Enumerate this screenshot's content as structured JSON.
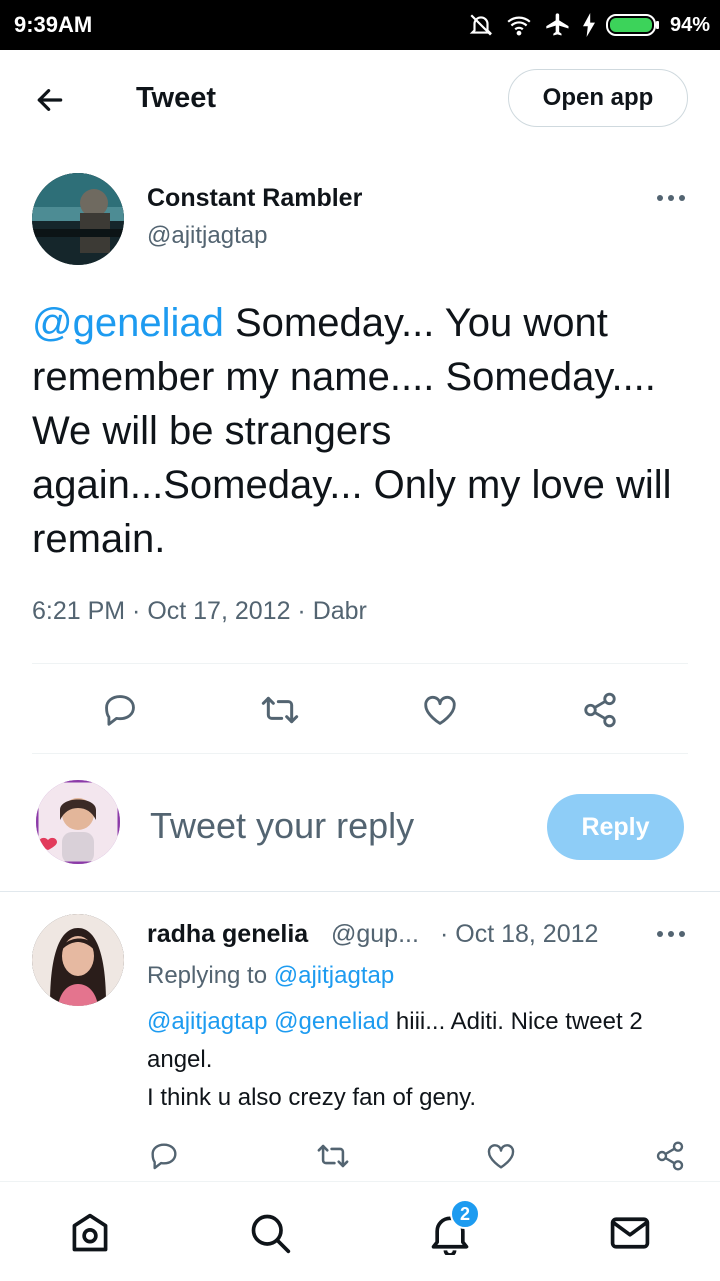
{
  "status_bar": {
    "time": "9:39AM",
    "battery": "94%"
  },
  "header": {
    "title": "Tweet",
    "open_app_label": "Open app"
  },
  "tweet": {
    "author_name": "Constant Rambler",
    "author_handle": "@ajitjagtap",
    "mention": "@geneliad",
    "text": " Someday... You wont remember my name.... Someday.... We will be strangers again...Someday... Only my love will remain.",
    "meta": "6:21 PM · Oct 17, 2012 · Dabr"
  },
  "composer": {
    "placeholder": "Tweet your reply",
    "reply_label": "Reply"
  },
  "reply": {
    "author_name": "radha genelia",
    "author_handle": "@gup...",
    "date": "· Oct 18, 2012",
    "replying_prefix": "Replying to ",
    "replying_to": "@ajitjagtap",
    "mention1": "@ajitjagtap",
    "mention2": "@geneliad",
    "text_line1": " hiii... Aditi. Nice tweet 2 angel.",
    "text_line2": "I think u also crezy fan of geny."
  },
  "bottom_nav": {
    "notification_count": "2"
  },
  "colors": {
    "accent": "#1d9bf0",
    "secondary_text": "#536471",
    "reply_button_disabled": "#8ecdf7"
  }
}
